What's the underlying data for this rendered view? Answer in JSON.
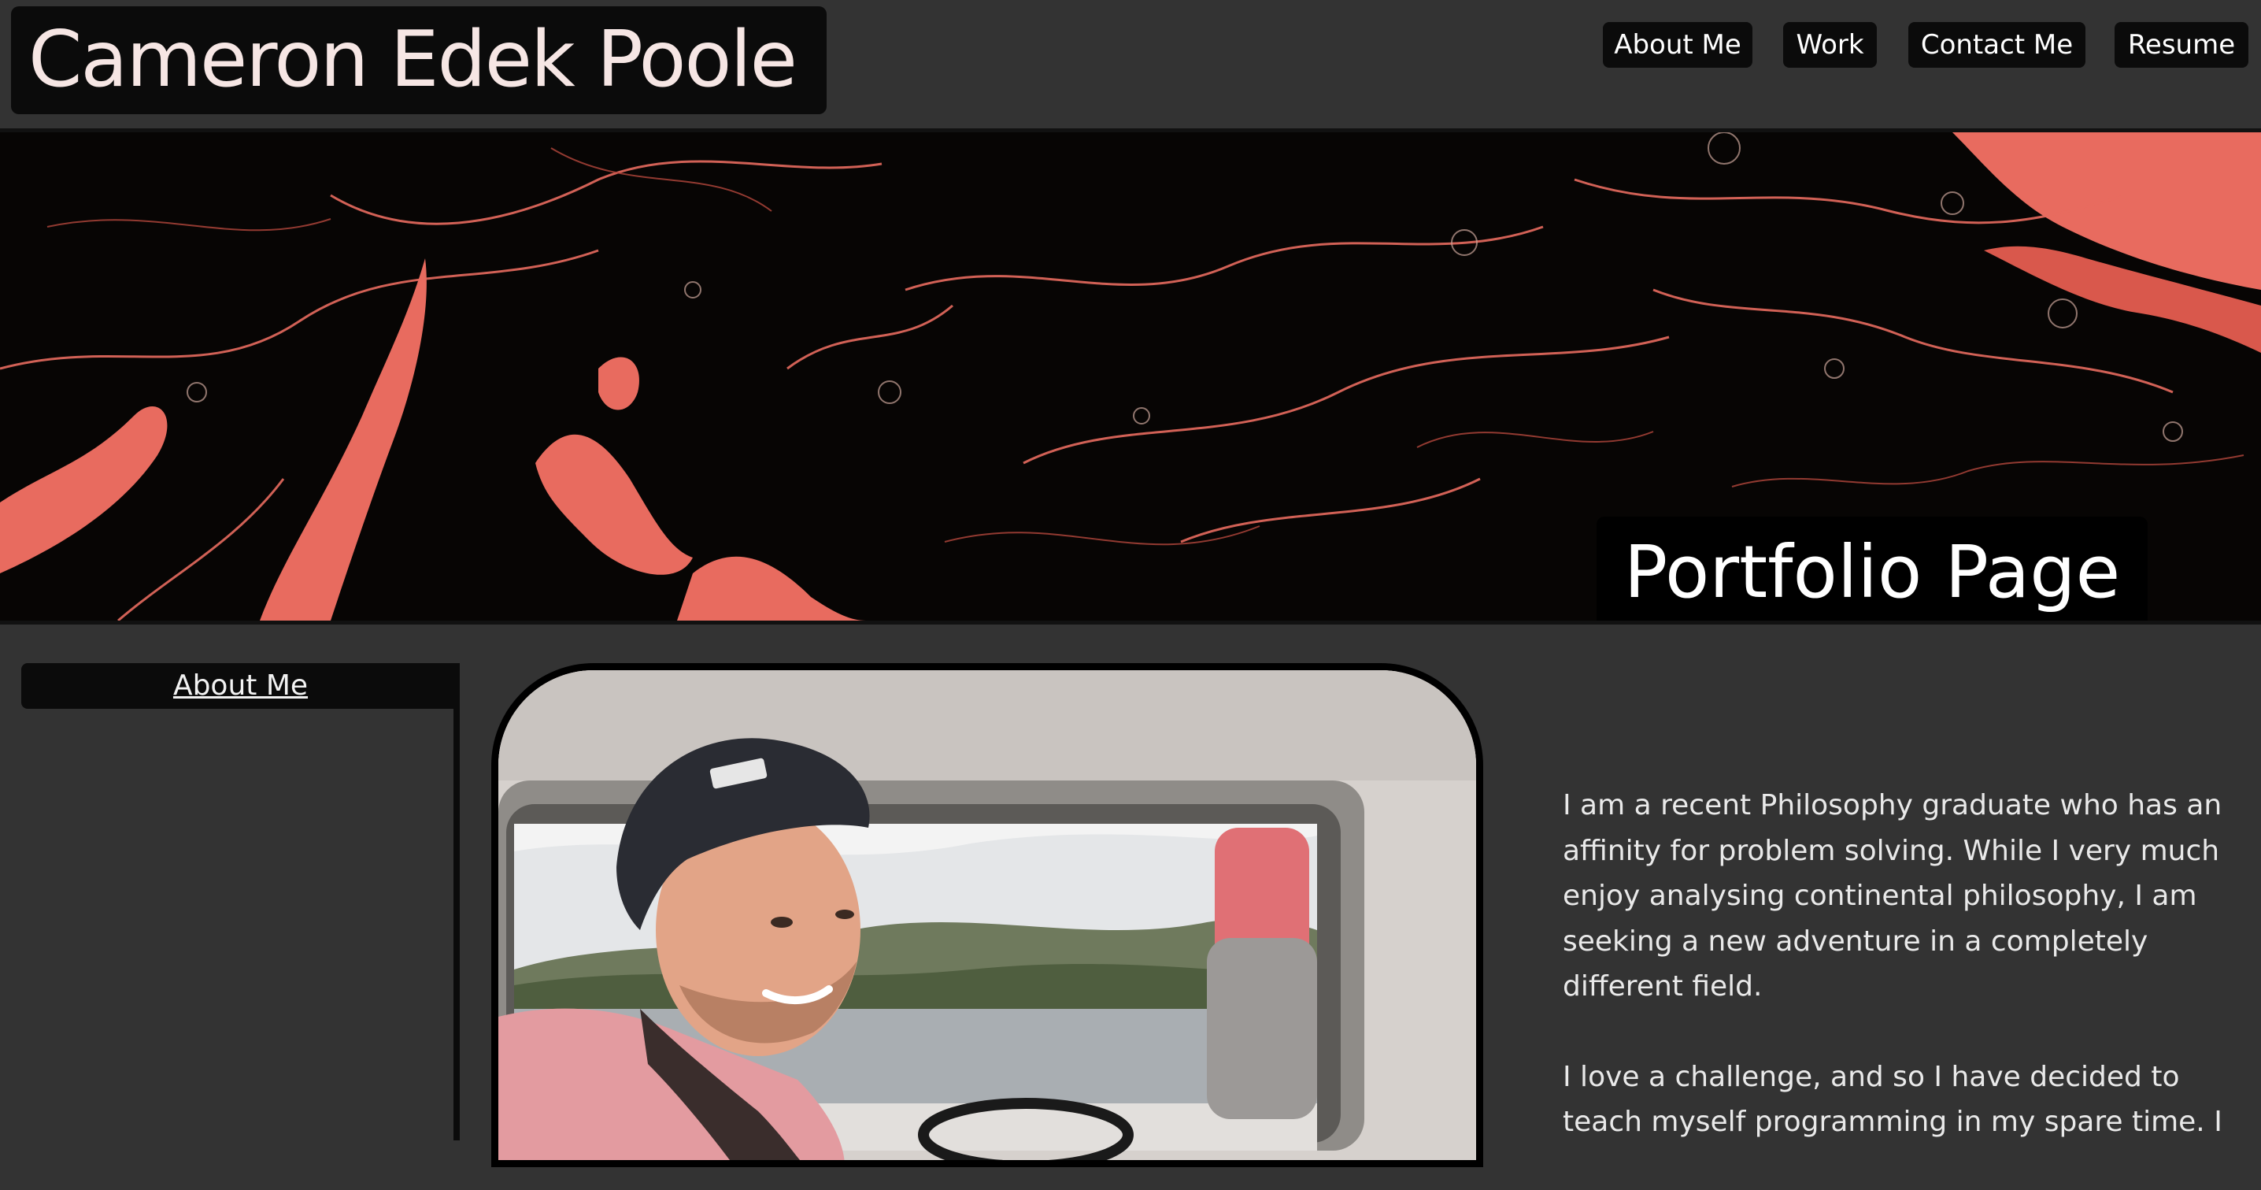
{
  "header": {
    "title": "Cameron Edek Poole",
    "nav": [
      "About Me",
      "Work",
      "Contact Me",
      "Resume"
    ]
  },
  "hero": {
    "label": "Portfolio Page"
  },
  "sidebar": {
    "items": [
      "About Me"
    ]
  },
  "about": {
    "paragraphs": [
      "I am a recent Philosophy graduate who has an affinity for problem solving. While I very much enjoy analysing continental philosophy, I am seeking a new adventure in a completely different field.",
      "I love a challenge, and so I have decided to teach myself programming in my spare time. I"
    ]
  },
  "colors": {
    "background": "#333333",
    "panel": "#0b0b0b",
    "accent": "#e96a5e"
  }
}
